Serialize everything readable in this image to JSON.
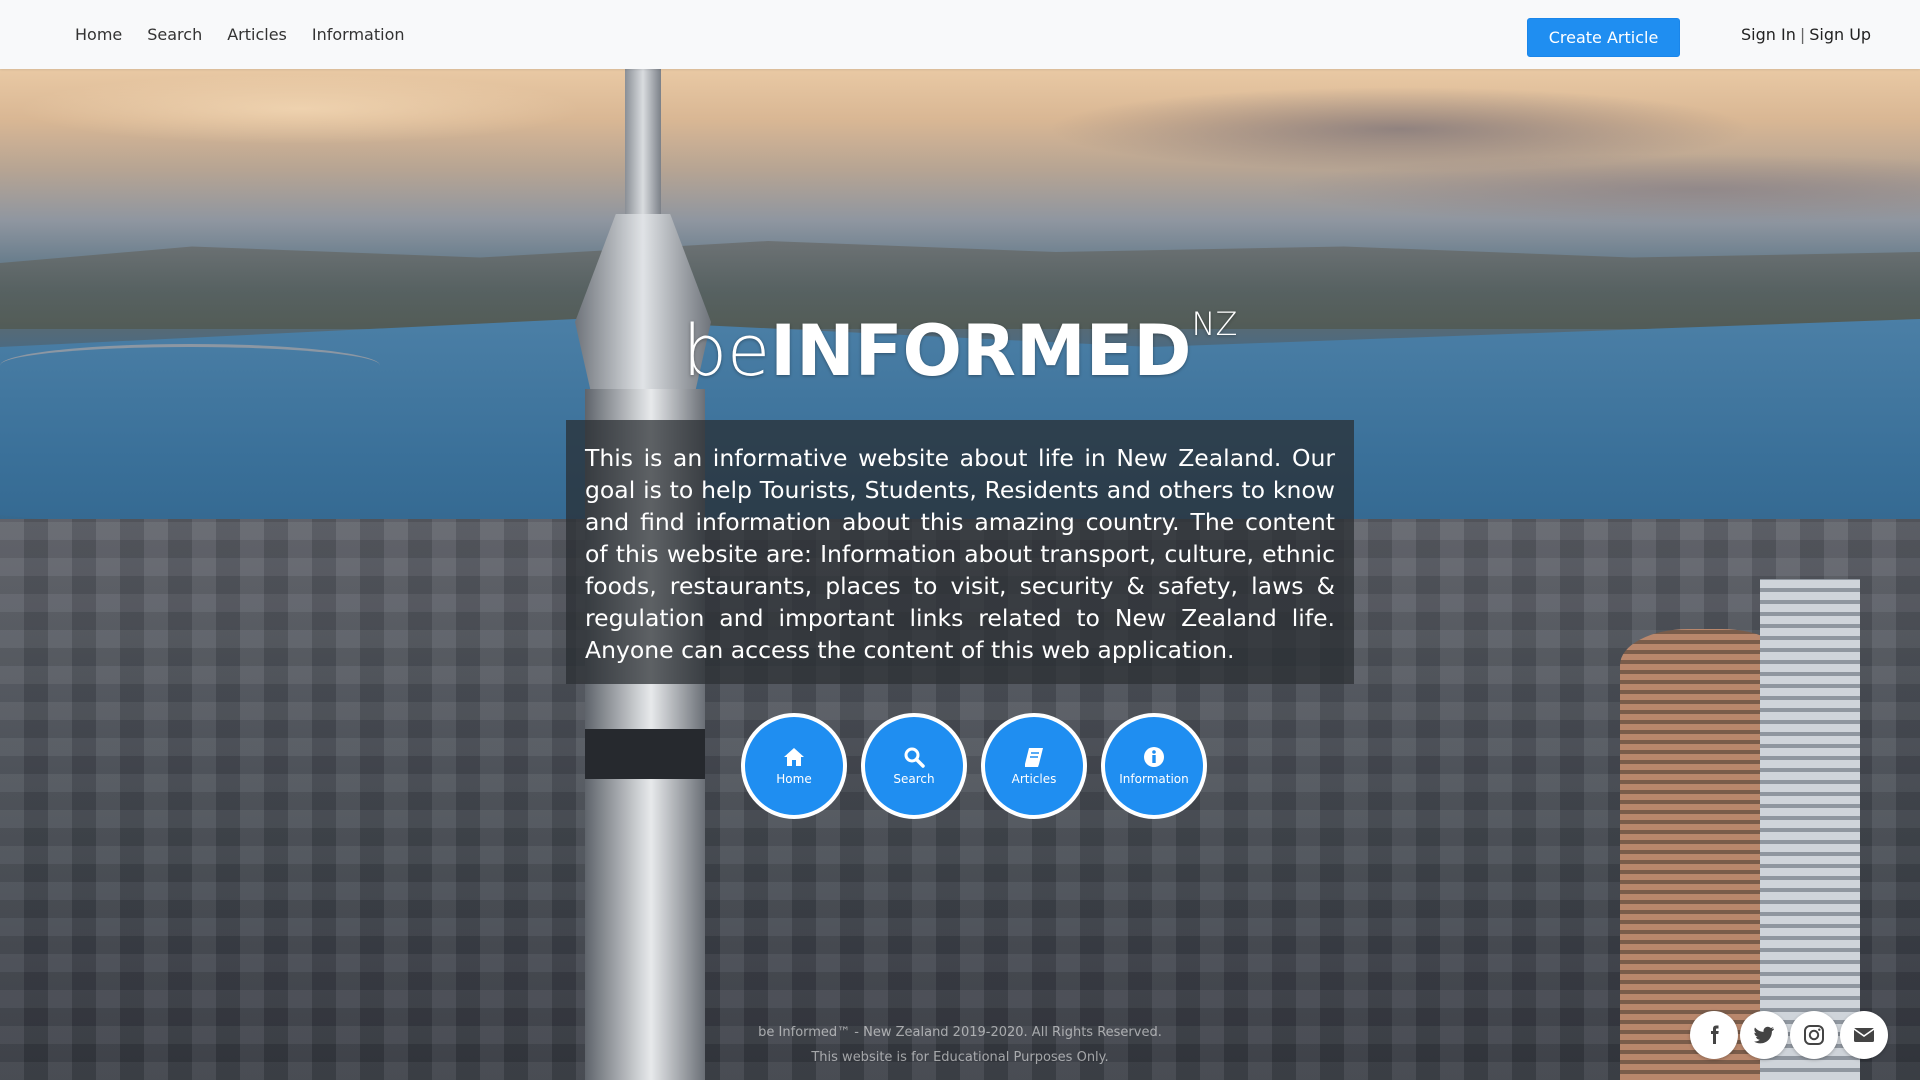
{
  "nav": {
    "links": [
      "Home",
      "Search",
      "Articles",
      "Information"
    ],
    "create_label": "Create Article",
    "sign_in": "Sign In",
    "separator": "|",
    "sign_up": "Sign Up"
  },
  "logo": {
    "be": "be",
    "informed": "INFORMED",
    "nz": "NZ"
  },
  "description": "This is an informative website about life in New Zealand. Our goal is to help Tourists, Students, Residents and others to know and find information about this amazing country. The content of this website are: Information about transport, culture, ethnic foods, restaurants, places to visit, security & safety, laws & regulation and important links related to New Zealand life. Anyone can access the content of this web application.",
  "circles": [
    {
      "label": "Home",
      "icon": "home-icon"
    },
    {
      "label": "Search",
      "icon": "search-icon"
    },
    {
      "label": "Articles",
      "icon": "book-icon"
    },
    {
      "label": "Information",
      "icon": "info-icon"
    }
  ],
  "footer": {
    "line1": "be Informed™ - New Zealand 2019-2020. All Rights Reserved.",
    "line2": "This website is for Educational Purposes Only."
  },
  "social": [
    "facebook-icon",
    "twitter-icon",
    "instagram-icon",
    "envelope-icon"
  ],
  "colors": {
    "accent": "#1f8ef1",
    "navbar_bg": "#f8f9fa",
    "desc_bg": "rgba(40,45,48,0.72)"
  }
}
